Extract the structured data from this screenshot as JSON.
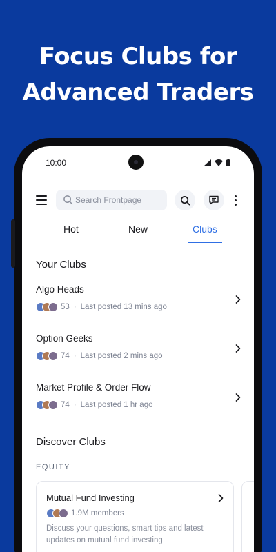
{
  "headline": {
    "line1": "Focus Clubs for",
    "line2": "Advanced Traders"
  },
  "status_bar": {
    "time": "10:00"
  },
  "search": {
    "placeholder": "Search Frontpage"
  },
  "tabs": [
    {
      "label": "Hot",
      "active": false
    },
    {
      "label": "New",
      "active": false
    },
    {
      "label": "Clubs",
      "active": true
    }
  ],
  "your_clubs": {
    "title": "Your Clubs",
    "items": [
      {
        "name": "Algo Heads",
        "members": "53",
        "last_posted": "Last posted 13 mins ago"
      },
      {
        "name": "Option Geeks",
        "members": "74",
        "last_posted": "Last posted 2 mins ago"
      },
      {
        "name": "Market Profile & Order Flow",
        "members": "74",
        "last_posted": "Last posted 1 hr ago"
      }
    ]
  },
  "discover": {
    "title": "Discover Clubs",
    "category": "EQUITY",
    "cards": [
      {
        "title": "Mutual Fund Investing",
        "members": "1.9M members",
        "description": "Discuss your questions, smart tips and latest updates on mutual fund investing"
      }
    ]
  },
  "colors": {
    "background": "#0a3a9e",
    "accent": "#2f6fe4"
  },
  "icons": {
    "menu": "hamburger-icon",
    "search": "search-icon",
    "chat": "chat-icon",
    "more": "kebab-icon",
    "chevron": "chevron-right-icon"
  }
}
